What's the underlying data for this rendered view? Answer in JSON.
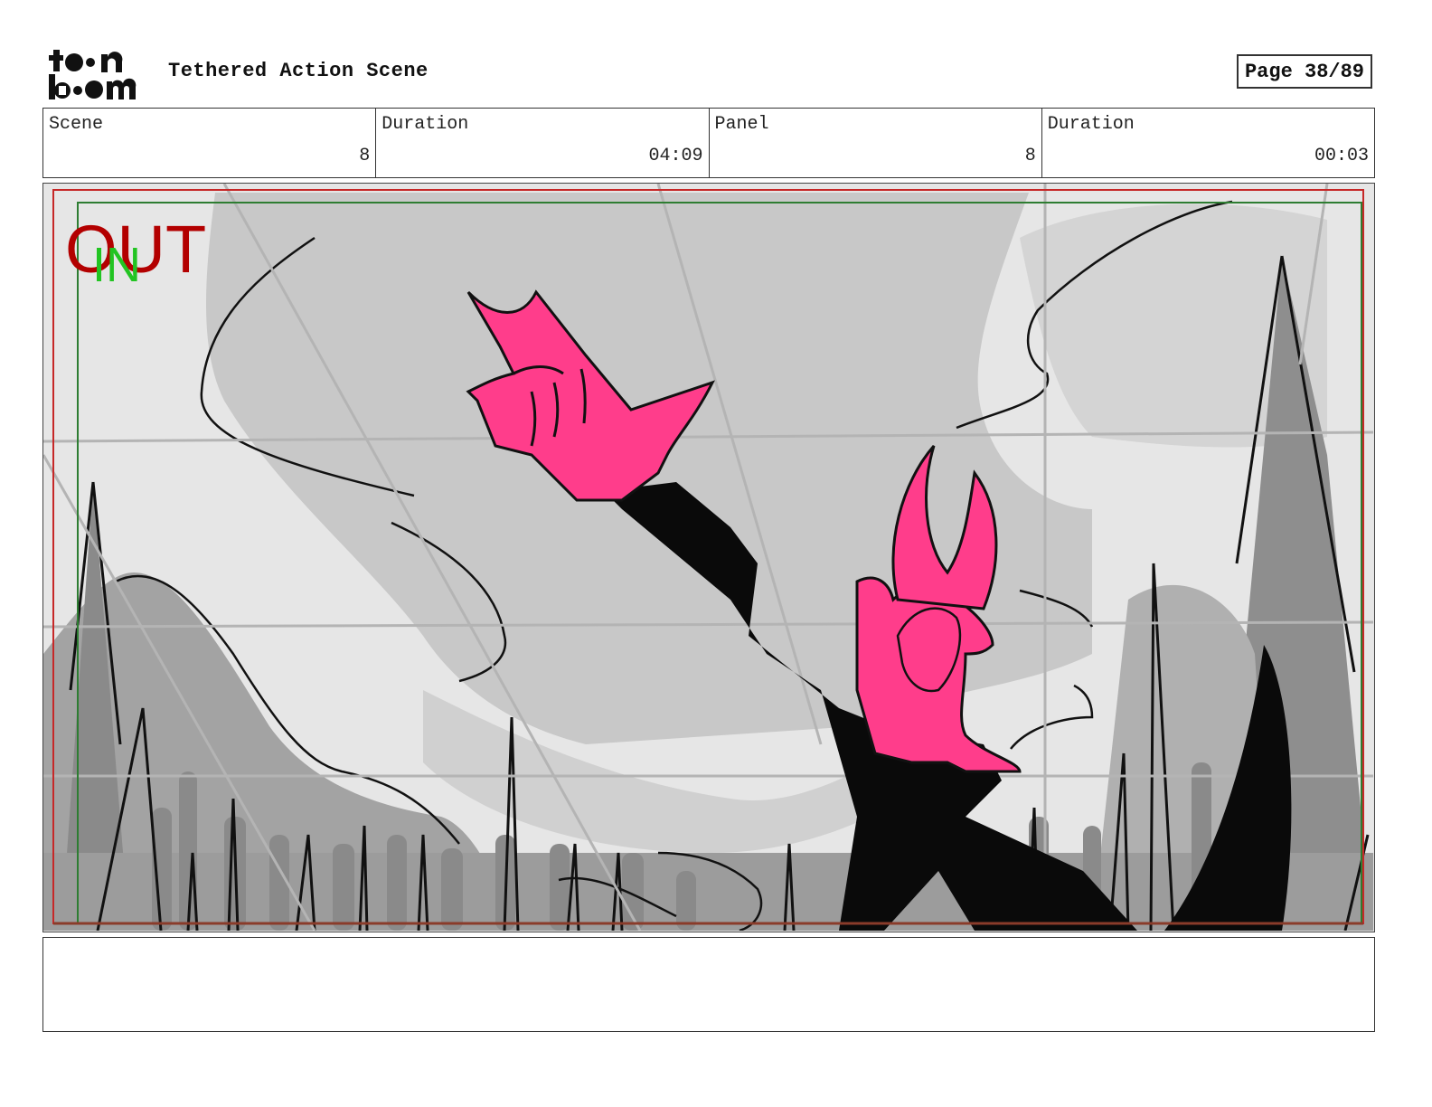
{
  "header": {
    "logo_text": "toon boom",
    "title": "Tethered Action Scene",
    "page": "Page 38/89"
  },
  "info": {
    "scene_label": "Scene",
    "scene_value": "8",
    "scene_duration_label": "Duration",
    "scene_duration_value": "04:09",
    "panel_label": "Panel",
    "panel_value": "8",
    "panel_duration_label": "Duration",
    "panel_duration_value": "00:03"
  },
  "panel": {
    "out_marker": "OUT",
    "in_marker": "IN"
  },
  "colors": {
    "character_pink": "#ff3d8b",
    "out_red": "#b30000",
    "in_green": "#22c422",
    "safe_frame_green": "#2e7d32",
    "camera_frame_red": "#c62828"
  },
  "notes": {
    "text": ""
  }
}
